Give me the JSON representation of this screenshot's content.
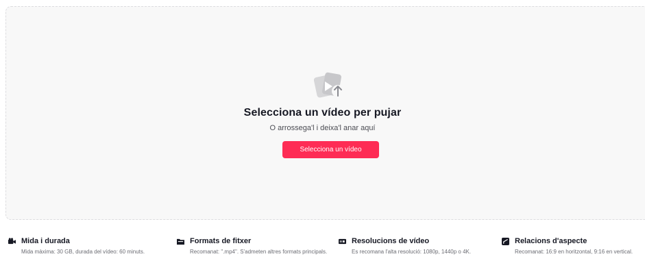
{
  "upload": {
    "icon": "video-upload-icon",
    "title": "Selecciona un vídeo per pujar",
    "subtitle": "O arrossega'l i deixa'l anar aquí",
    "button_label": "Selecciona un vídeo",
    "button_color": "#fe2c55"
  },
  "info": [
    {
      "icon": "video-camera-icon",
      "title": "Mida i durada",
      "description": "Mida màxima: 30 GB, durada del vídeo: 60 minuts."
    },
    {
      "icon": "folder-icon",
      "title": "Formats de fitxer",
      "description": "Recomanat: \".mp4\". S'admeten altres formats principals."
    },
    {
      "icon": "hd-badge-icon",
      "title": "Resolucions de vídeo",
      "description": "Es recomana l'alta resolució: 1080p, 1440p o 4K."
    },
    {
      "icon": "aspect-ratio-icon",
      "title": "Relacions d'aspecte",
      "description": "Recomanat: 16:9 en horitzontal, 9:16 en vertical."
    }
  ]
}
